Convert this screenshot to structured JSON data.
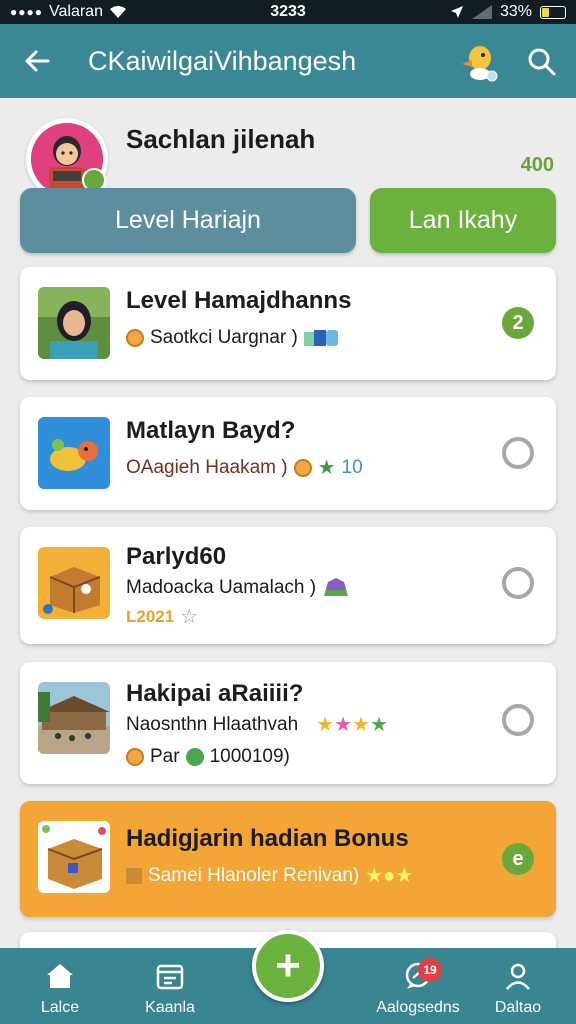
{
  "status_bar": {
    "carrier": "Valaran",
    "time": "3233",
    "battery": "33%",
    "battery_level": 0.33
  },
  "header": {
    "title": "CKaiwilgaiVihbangesh",
    "back_icon": "arrow-left-icon",
    "mascot_icon": "duck-mascot-icon",
    "search_icon": "search-icon"
  },
  "profile": {
    "name": "Sachlan jilenah",
    "points": "400",
    "level_button": "Level Hariajn",
    "action_button": "Lan Ikahy"
  },
  "tasks": [
    {
      "title": "Level Hamajdhanns",
      "subtitle": "Saotkci Uargnar )",
      "status": "2",
      "thumb": "person-photo"
    },
    {
      "title": "Matlayn Bayd?",
      "subtitle": "OAagieh Haakam )",
      "meta": "10",
      "status": "",
      "thumb": "toy-icon"
    },
    {
      "title": "Parlyd60",
      "subtitle": "Madoacka Uamalach )",
      "meta": "L2021",
      "status": "",
      "thumb": "box-icon"
    },
    {
      "title": "Hakipai aRaiiii?",
      "subtitle": "Naosnthn Hlaathvah",
      "meta_label": "Par",
      "meta": "1000109)",
      "status": "",
      "thumb": "building-photo"
    },
    {
      "title": "Hadigjarin hadian Bonus",
      "subtitle": "Samei Hlanoler Renivan)",
      "status": "e",
      "thumb": "gift-box-icon"
    }
  ],
  "colors": {
    "header": "#3a8896",
    "green": "#6ab13d",
    "orange_card": "#f3a636",
    "nav": "#3a8592"
  },
  "nav": {
    "items": [
      {
        "label": "Lalce",
        "icon": "home-icon"
      },
      {
        "label": "Kaanla",
        "icon": "calendar-icon"
      },
      {
        "label": "Aalogsedns",
        "icon": "chat-icon",
        "badge": "19"
      },
      {
        "label": "Daltao",
        "icon": "profile-icon"
      }
    ],
    "fab_icon": "plus-icon",
    "fab_label": "+"
  }
}
